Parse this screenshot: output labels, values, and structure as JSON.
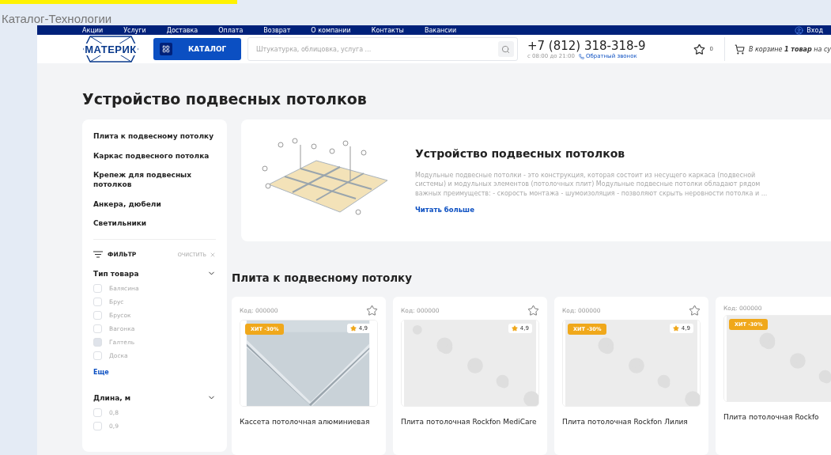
{
  "page_title": "Каталог-Технологии",
  "top_nav": {
    "links": [
      "Акции",
      "Услуги",
      "Доставка",
      "Оплата",
      "Возврат",
      "О компании",
      "Контакты",
      "Вакансии"
    ],
    "login": "Вход"
  },
  "header": {
    "logo": "МАТЕРИК",
    "catalog_button": "КАТАЛОГ",
    "search": {
      "placeholder": "Штукатурка, облицовка, услуга ..."
    },
    "phone": "+7 (812) 318-318-9",
    "hours": "с 08:00 до 21:00",
    "callback": "Обратный звонок",
    "favorites_count": "0",
    "cart": "В корзине **1 товар** на су"
  },
  "heading": "Устройство подвесных потолков",
  "sidebar": {
    "categories": [
      "Плита к подвесному потолку",
      "Каркас подвесного потолка",
      "Крепеж для подвесных потолков",
      "Анкера, дюбели",
      "Светильники"
    ],
    "filter": {
      "title": "ФИЛЬТР",
      "clear": "ОЧИСТИТЬ",
      "groups": [
        {
          "title": "Тип товара",
          "expanded": true,
          "options": [
            {
              "label": "Балясина",
              "checked": false
            },
            {
              "label": "Брус",
              "checked": false
            },
            {
              "label": "Брусок",
              "checked": false
            },
            {
              "label": "Вагонка",
              "checked": false
            },
            {
              "label": "Галтель",
              "checked": true
            },
            {
              "label": "Доска",
              "checked": false
            }
          ],
          "more": "Еще"
        },
        {
          "title": "Длина, м",
          "expanded": true,
          "options": [
            {
              "label": "0,8",
              "checked": false
            },
            {
              "label": "0,9",
              "checked": false
            }
          ]
        }
      ]
    }
  },
  "intro": {
    "title": "Устройство подвесных потолков",
    "text": "Модульные подвесные потолки - это конструкция, которая состоит из несущего каркаса (подвесной системы) и модульных элементов (потолочных плит) Модульные подвесные потолки обладают рядом важных преимуществ: - скорость монтажа - шумоизоляция - позволяют скрыть неровности потолка и ...",
    "read_more": "Читать больше"
  },
  "section_title": "Плита к подвесному потолку",
  "products": [
    {
      "code": "Код: 000000",
      "badge": "ХИТ -30%",
      "rating": "4,9",
      "kind": "panel",
      "name": "Кассета потолочная алюминиевая"
    },
    {
      "code": "Код: 000000",
      "rating": "4,9",
      "kind": "texture",
      "name": "Плита потолочная Rockfon MediCare"
    },
    {
      "code": "Код: 000000",
      "badge": "ХИТ -30%",
      "rating": "4,9",
      "kind": "texture",
      "name": "Плита потолочная Rockfon Лилия"
    },
    {
      "code": "Код: 000000",
      "badge": "ХИТ -30%",
      "kind": "texture",
      "name": "Плита потолочная Rockfo"
    }
  ]
}
